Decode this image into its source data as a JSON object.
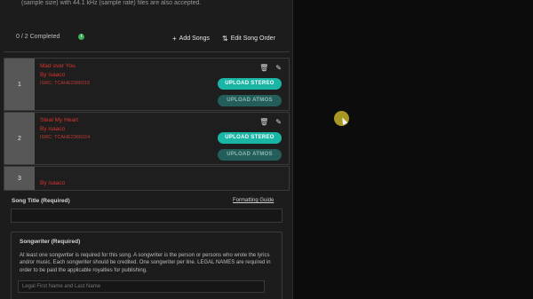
{
  "header": {
    "note": "(sample size) with 44.1 kHz (sample rate) files are also accepted."
  },
  "progress": {
    "completed_text": "0 / 2 Completed",
    "info_icon": "info-circle-icon"
  },
  "actions": {
    "add_songs": "Add Songs",
    "edit_order": "Edit Song Order"
  },
  "songs": [
    {
      "number": "1",
      "title": "Mad over You",
      "artist": "By isaaco",
      "isrc": "ISRC: TCAHE2365016",
      "upload_stereo": "UPLOAD STEREO",
      "upload_atmos": "UPLOAD ATMOS"
    },
    {
      "number": "2",
      "title": "Steal My Heart",
      "artist": "By isaaco",
      "isrc": "ISRC: TCAHE2365024",
      "upload_stereo": "UPLOAD STEREO",
      "upload_atmos": "UPLOAD ATMOS"
    },
    {
      "number": "3",
      "artist": "By isaaco"
    }
  ],
  "form": {
    "song_title_label": "Song Title (Required)",
    "formatting_guide": "Formatting Guide",
    "song_title_value": "",
    "songwriter_label": "Songwriter (Required)",
    "songwriter_description": "At least one songwriter is required for this song. A songwriter is the person or persons who wrote the lyrics and/or music. Each songwriter should be credited. One songwriter per line. LEGAL NAMES are required in order to be paid the applicable royalties for publishing.",
    "songwriter_placeholder": "Legal First Name and Last Name"
  },
  "colors": {
    "accent_teal": "#19b5a5",
    "atmos_teal": "#245e5a",
    "song_text_red": "#d9332c",
    "panel_bg": "#1c1c1c",
    "page_bg": "#0c0c0c"
  }
}
